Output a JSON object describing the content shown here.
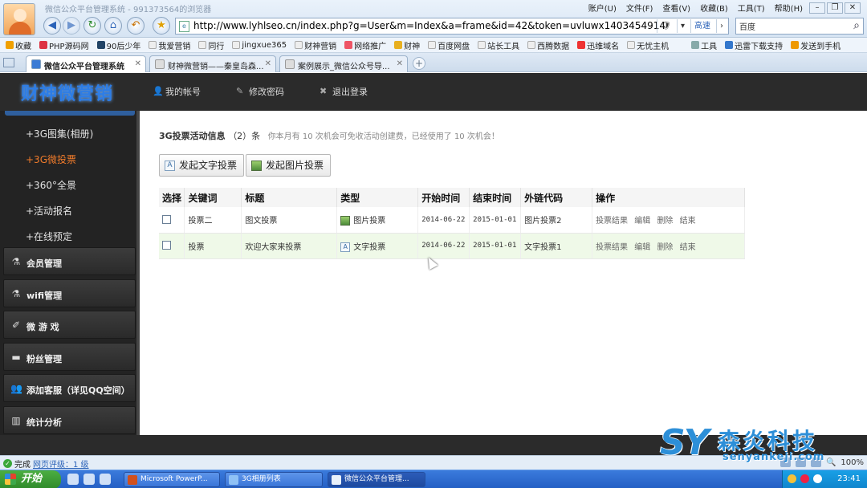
{
  "browser": {
    "window_title": "微信公众平台管理系统 - 991373564的浏览器",
    "menu": [
      "账户(U)",
      "文件(F)",
      "查看(V)",
      "收藏(B)",
      "工具(T)",
      "帮助(H)"
    ],
    "url": "http://www.lyhlseo.cn/index.php?g=User&m=Index&a=frame&id=42&token=uvluwx1403454914",
    "fast_label": "高速",
    "search_engine": "百度",
    "bookmarks": [
      "收藏",
      "PHP源码网",
      "90后少年",
      "我爱营销",
      "同行",
      "jingxue365",
      "财神营销",
      "网络推广",
      "财神",
      "百度网盘",
      "站长工具",
      "西腾数据",
      "迅维域名",
      "无忧主机",
      "工具",
      "迅雷下载支持",
      "发送到手机"
    ],
    "tabs": [
      {
        "label": "微信公众平台管理系统"
      },
      {
        "label": "财神微营销——秦皇岛森..."
      },
      {
        "label": "案例展示_微信公众号导..."
      }
    ],
    "status": {
      "left": "完成",
      "rating": "网页评级：1 级",
      "zoom": "100%"
    }
  },
  "site": {
    "brand": "财神微营销",
    "topnav": [
      {
        "label": "我的帐号",
        "icon": "user-icon"
      },
      {
        "label": "修改密码",
        "icon": "edit-icon"
      },
      {
        "label": "退出登录",
        "icon": "logout-icon"
      }
    ]
  },
  "sidebar": {
    "sub_items": [
      {
        "label": "+3G图集(相册)",
        "active": false
      },
      {
        "label": "+3G微投票",
        "active": true
      },
      {
        "label": "+360°全景",
        "active": false
      },
      {
        "label": "+活动报名",
        "active": false
      },
      {
        "label": "+在线预定",
        "active": false
      }
    ],
    "sections": [
      {
        "label": "会员管理",
        "icon": "flask-icon"
      },
      {
        "label": "wifi管理",
        "icon": "flask-icon"
      },
      {
        "label": "微 游 戏",
        "icon": "brush-icon"
      },
      {
        "label": "粉丝管理",
        "icon": "card-icon"
      },
      {
        "label": "添加客服（详见QQ空间）",
        "icon": "users-icon"
      },
      {
        "label": "统计分析",
        "icon": "chart-icon"
      }
    ]
  },
  "main": {
    "title": "3G投票活动信息",
    "count": "（2）条",
    "note": "你本月有 10 次机会可免收活动创建费，已经使用了 10 次机会！",
    "buttons": {
      "text_vote": "发起文字投票",
      "image_vote": "发起图片投票"
    },
    "columns": [
      "选择",
      "关键词",
      "标题",
      "类型",
      "开始时间",
      "结束时间",
      "外链代码",
      "操作"
    ],
    "rows": [
      {
        "keyword": "投票二",
        "title": "图文投票",
        "type": "图片投票",
        "type_icon": "image-icon",
        "start": "2014-06-22",
        "end": "2015-01-01",
        "link": "图片投票2"
      },
      {
        "keyword": "投票",
        "title": "欢迎大家来投票",
        "type": "文字投票",
        "type_icon": "text-icon",
        "start": "2014-06-22",
        "end": "2015-01-01",
        "link": "文字投票1"
      }
    ],
    "ops": [
      "投票结果",
      "编辑",
      "删除",
      "结束"
    ]
  },
  "taskbar": {
    "start": "开始",
    "tasks": [
      "Microsoft PowerP...",
      "3G相册列表",
      "微信公众平台管理..."
    ],
    "clock": "23:41"
  },
  "watermark": {
    "logo": "SY",
    "name": "森炎科技",
    "domain": "senyankeji.com"
  },
  "colors": {
    "accent": "#2d7de6",
    "active_menu": "#f07b2b",
    "sidebar_bg": "#232323",
    "alt_row": "#eff9e8"
  }
}
